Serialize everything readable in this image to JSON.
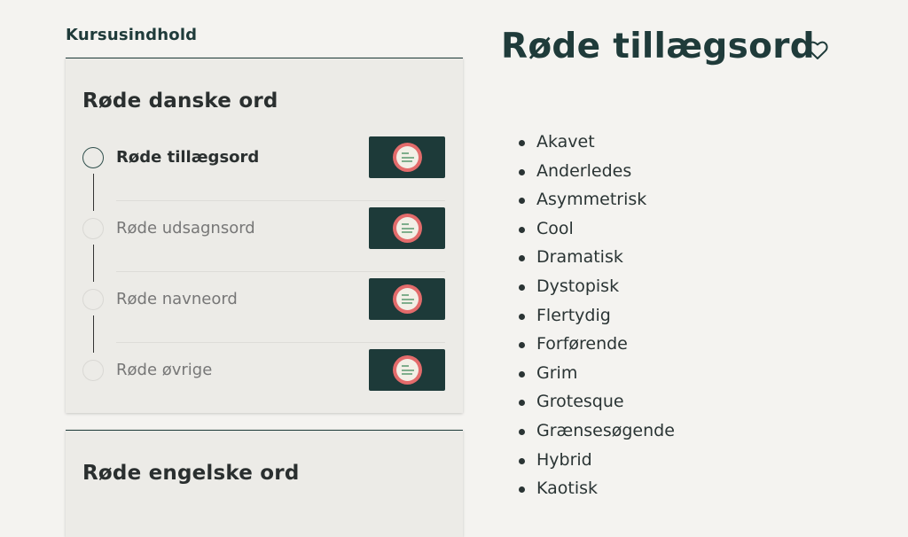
{
  "sidebar": {
    "heading": "Kursusindhold",
    "sections": [
      {
        "title": "Røde danske ord",
        "lessons": [
          {
            "label": "Røde tillægsord",
            "active": true
          },
          {
            "label": "Røde udsagnsord",
            "active": false
          },
          {
            "label": "Røde navneord",
            "active": false
          },
          {
            "label": "Røde øvrige",
            "active": false
          }
        ]
      },
      {
        "title": "Røde engelske ord"
      }
    ]
  },
  "main": {
    "title": "Røde tillægsord",
    "words": [
      "Akavet",
      "Anderledes",
      "Asymmetrisk",
      "Cool",
      "Dramatisk",
      "Dystopisk",
      "Flertydig",
      "Forførende",
      "Grim",
      "Grotesque",
      "Grænsesøgende",
      "Hybrid",
      "Kaotisk"
    ]
  },
  "icons": {
    "favorite": "heart-outline-icon",
    "thumbnail": "course-badge-icon"
  },
  "colors": {
    "accent": "#1f3b3a",
    "thumb_bg": "#1d3a39",
    "badge": "#e36b6b",
    "page_bg": "#f4f3f0"
  }
}
